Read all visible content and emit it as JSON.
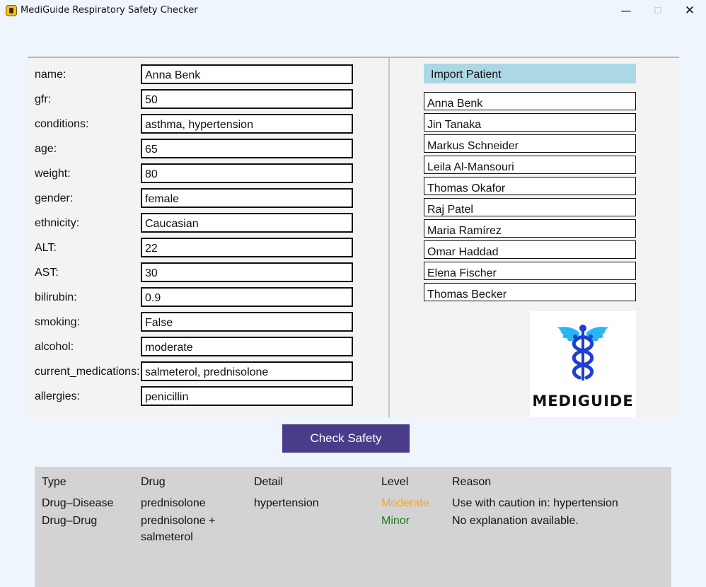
{
  "window": {
    "title": "MediGuide Respiratory Safety Checker",
    "controls": {
      "minimize": "—",
      "maximize": "☐",
      "close": "✕"
    }
  },
  "form": {
    "fields": [
      {
        "label": "name:",
        "value": "Anna Benk"
      },
      {
        "label": "gfr:",
        "value": "50"
      },
      {
        "label": "conditions:",
        "value": "asthma, hypertension"
      },
      {
        "label": "age:",
        "value": "65"
      },
      {
        "label": "weight:",
        "value": "80"
      },
      {
        "label": "gender:",
        "value": "female"
      },
      {
        "label": "ethnicity:",
        "value": "Caucasian"
      },
      {
        "label": "ALT:",
        "value": "22"
      },
      {
        "label": "AST:",
        "value": "30"
      },
      {
        "label": "bilirubin:",
        "value": "0.9"
      },
      {
        "label": "smoking:",
        "value": "False"
      },
      {
        "label": "alcohol:",
        "value": "moderate"
      },
      {
        "label": "current_medications:",
        "value": "salmeterol, prednisolone"
      },
      {
        "label": "allergies:",
        "value": "penicillin"
      }
    ]
  },
  "import_panel": {
    "button_label": "Import Patient",
    "patients": [
      "Anna Benk",
      "Jin Tanaka",
      "Markus Schneider",
      "Leila Al-Mansouri",
      "Thomas Okafor",
      "Raj Patel",
      "Maria Ramírez",
      "Omar Haddad",
      "Elena Fischer",
      "Thomas Becker"
    ]
  },
  "logo": {
    "text": "MEDIGUIDE",
    "icon": "caduceus-icon",
    "color": "#1e3fd0",
    "accent": "#29b6f6"
  },
  "check_button": {
    "label": "Check Safety",
    "color": "#4a3c8a"
  },
  "results": {
    "headers": {
      "type": "Type",
      "drug": "Drug",
      "detail": "Detail",
      "level": "Level",
      "reason": "Reason"
    },
    "rows": [
      {
        "type": "Drug–Disease",
        "drug": "prednisolone",
        "detail": "hypertension",
        "level": "Moderate",
        "level_color": "#f5a623",
        "reason": "Use with caution in: hypertension"
      },
      {
        "type": "Drug–Drug",
        "drug": "prednisolone + salmeterol",
        "detail": "",
        "level": "Minor",
        "level_color": "#1f7a1f",
        "reason": "No explanation available."
      }
    ]
  }
}
